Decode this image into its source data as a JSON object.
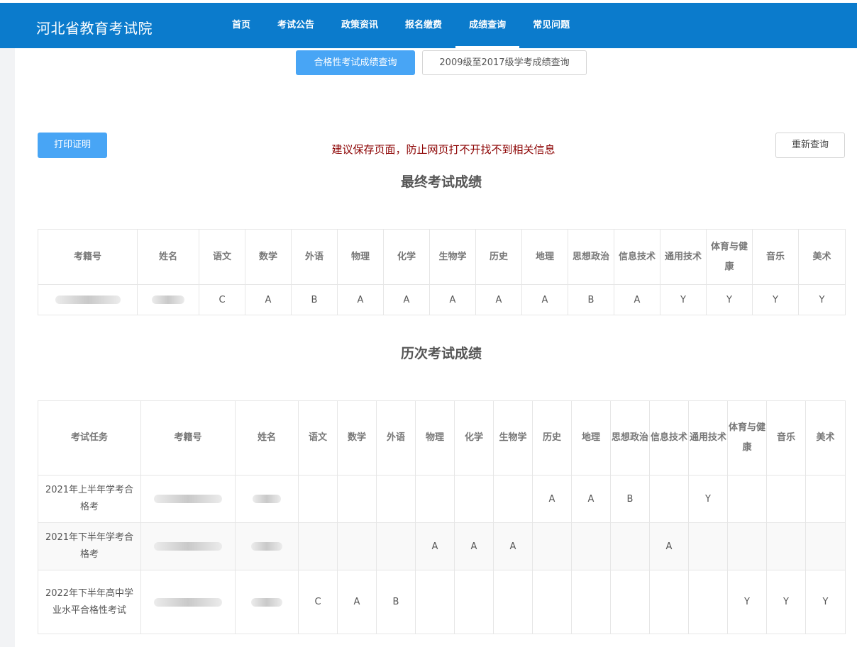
{
  "header": {
    "logo": "河北省教育考试院",
    "nav": [
      "首页",
      "考试公告",
      "政策资讯",
      "报名缴费",
      "成绩查询",
      "常见问题"
    ],
    "active_nav": "成绩查询"
  },
  "tabs": {
    "active": "合格性考试成绩查询",
    "other": "2009级至2017级学考成绩查询"
  },
  "actions": {
    "print_label": "打印证明",
    "requery_label": "重新查询",
    "notice": "建议保存页面，防止网页打不开找不到相关信息"
  },
  "final": {
    "title": "最终考试成绩",
    "headers": [
      "考籍号",
      "姓名",
      "语文",
      "数学",
      "外语",
      "物理",
      "化学",
      "生物学",
      "历史",
      "地理",
      "思想政治",
      "信息技术",
      "通用技术",
      "体育与健康",
      "音乐",
      "美术"
    ],
    "row": [
      "C",
      "A",
      "B",
      "A",
      "A",
      "A",
      "A",
      "A",
      "B",
      "A",
      "Y",
      "Y",
      "Y",
      "Y"
    ]
  },
  "history": {
    "title": "历次考试成绩",
    "headers": [
      "考试任务",
      "考籍号",
      "姓名",
      "语文",
      "数学",
      "外语",
      "物理",
      "化学",
      "生物学",
      "历史",
      "地理",
      "思想政治",
      "信息技术",
      "通用技术",
      "体育与健康",
      "音乐",
      "美术"
    ],
    "rows": [
      {
        "task": "2021年上半年学考合格考",
        "grades": [
          "",
          "",
          "",
          "",
          "",
          "",
          "A",
          "A",
          "B",
          "",
          "Y",
          "",
          "",
          ""
        ]
      },
      {
        "task": "2021年下半年学考合格考",
        "grades": [
          "",
          "",
          "",
          "A",
          "A",
          "A",
          "",
          "",
          "",
          "A",
          "",
          "",
          "",
          ""
        ]
      },
      {
        "task": "2022年下半年高中学业水平合格性考试",
        "grades": [
          "C",
          "A",
          "B",
          "",
          "",
          "",
          "",
          "",
          "",
          "",
          "",
          "Y",
          "Y",
          "Y"
        ]
      }
    ]
  },
  "colors": {
    "header_bg": "#0b7bcc",
    "primary_button": "#48a5f5",
    "notice_text": "#8b0000"
  }
}
